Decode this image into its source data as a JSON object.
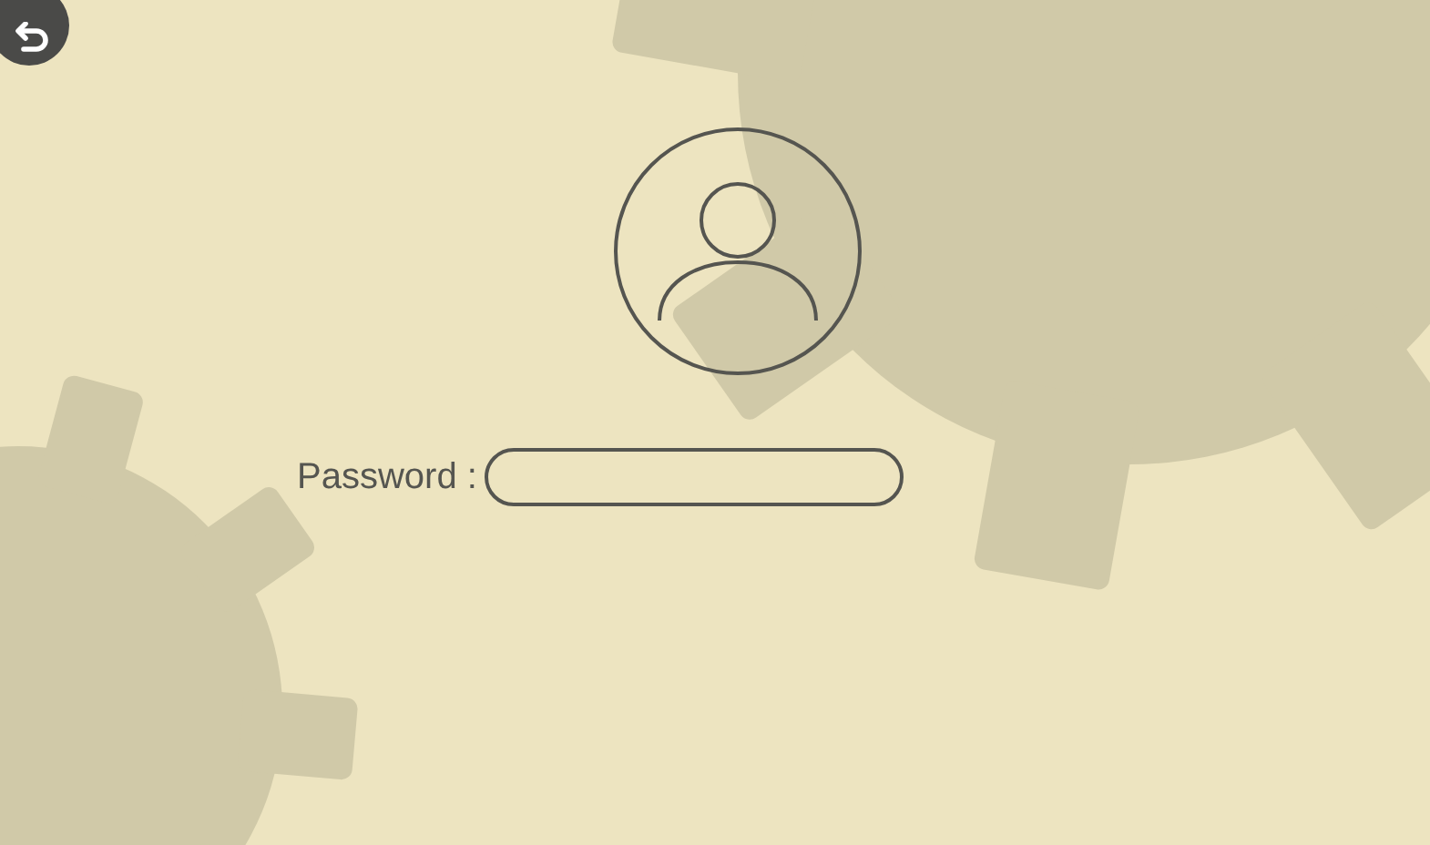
{
  "login": {
    "password_label": "Password :"
  }
}
